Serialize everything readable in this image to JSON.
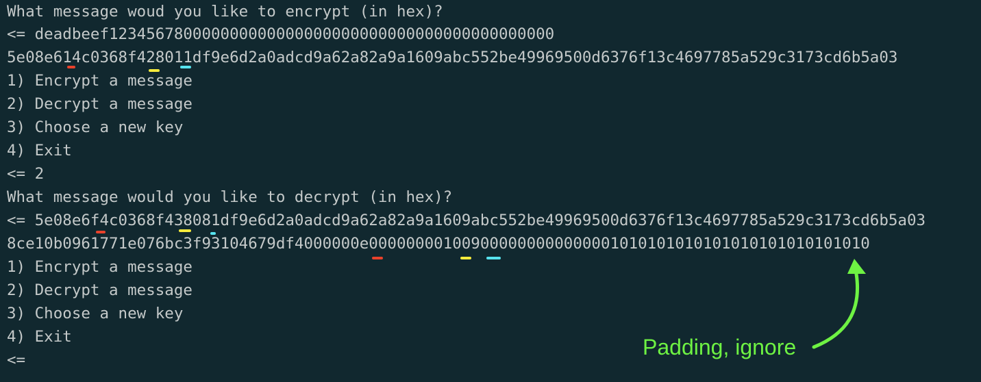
{
  "terminal": {
    "lines": [
      "What message woud you like to encrypt (in hex)?",
      "<= deadbeef123456780000000000000000000000000000000000000000",
      "5e08e614c0368f428011df9e6d2a0adcd9a62a82a9a1609abc552be49969500d6376f13c4697785a529c3173cd6b5a03",
      "1) Encrypt a message",
      "2) Decrypt a message",
      "3) Choose a new key",
      "4) Exit",
      "<= 2",
      "What message would you like to decrypt (in hex)?",
      "<= 5e08e6f4c0368f438081df9e6d2a0adcd9a62a82a9a1609abc552be49969500d6376f13c4697785a529c3173cd6b5a03",
      "8ce10b0961771e076bc3f93104679df4000000e000000001009000000000000001010101010101010101010101010",
      "1) Encrypt a message",
      "2) Decrypt a message",
      "3) Choose a new key",
      "4) Exit",
      "<="
    ]
  },
  "annotation": {
    "text": "Padding, ignore"
  },
  "colors": {
    "background": "#11282f",
    "terminal_text": "#c4c9c9",
    "annotation": "#6ef243",
    "mark_red": "#e8422b",
    "mark_yellow": "#f7eb3c",
    "mark_cyan": "#57e3ee"
  }
}
